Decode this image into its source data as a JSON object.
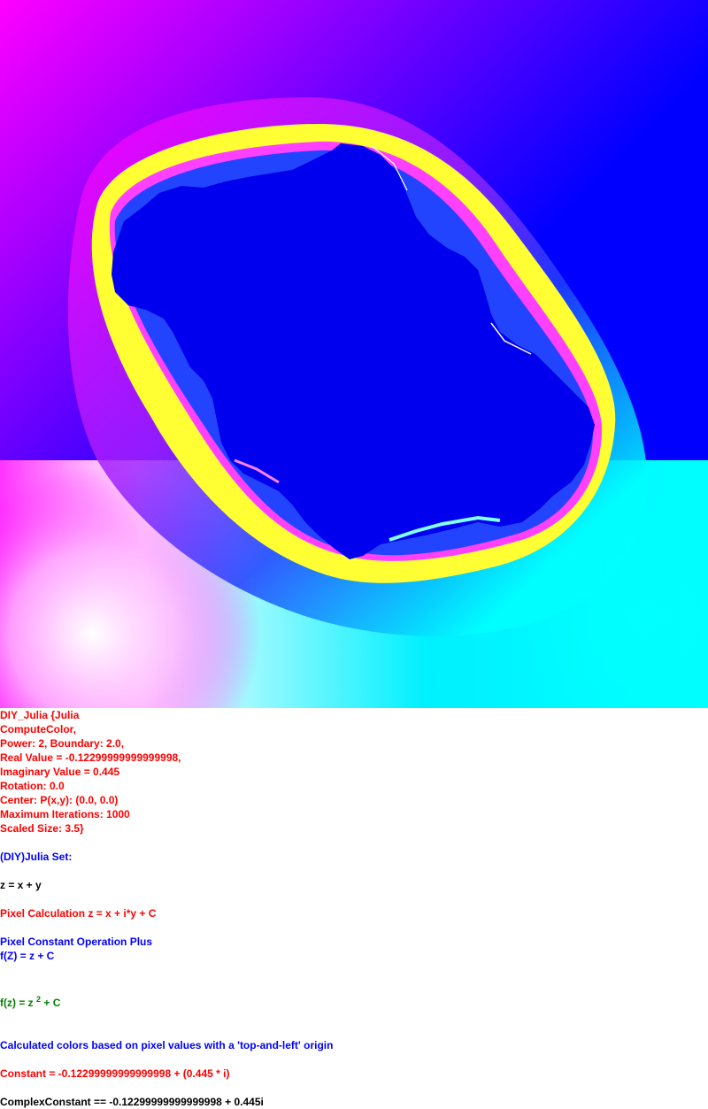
{
  "info": {
    "lines": [
      "DIY_Julia {Julia",
      "ComputeColor,",
      "Power: 2, Boundary: 2.0,",
      "Real Value = -0.12299999999999998,",
      "Imaginary Value = 0.445",
      "Rotation: 0.0",
      "Center: P(x,y): (0.0, 0.0)",
      "Maximum Iterations: 1000",
      "Scaled Size: 3.5}"
    ]
  },
  "formula": {
    "set_title": "(DIY)Julia Set:",
    "z_def": "z = x + y",
    "pixel_calc": "Pixel Calculation z = x + i*y + C",
    "operation": "Pixel Constant Operation Plus",
    "fz_plus": "f(Z) = z + C",
    "fz_power_prefix": "f(z) = z",
    "fz_power_exp": "2",
    "fz_power_suffix": " + C",
    "color_note": "Calculated colors based on pixel values with a 'top-and-left' origin",
    "constant": "Constant = -0.12299999999999998 + (0.445 * i)",
    "complex_constant": "ComplexConstant == -0.12299999999999998 + 0.445i"
  },
  "colors": {
    "red": "#ff0000",
    "blue": "#0000ff",
    "black": "#000000",
    "green": "#008000"
  }
}
